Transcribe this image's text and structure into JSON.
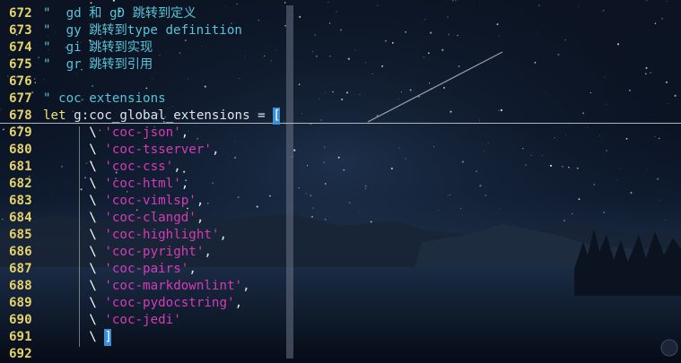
{
  "editor": {
    "lines": [
      {
        "num": "672",
        "parts": [
          {
            "c": "cmt",
            "t": "\"  gd 和 gD 跳转到定义"
          }
        ]
      },
      {
        "num": "673",
        "parts": [
          {
            "c": "cmt",
            "t": "\"  gy 跳转到type definition"
          }
        ]
      },
      {
        "num": "674",
        "parts": [
          {
            "c": "cmt",
            "t": "\"  gi 跳转到实现"
          }
        ]
      },
      {
        "num": "675",
        "parts": [
          {
            "c": "cmt",
            "t": "\"  gr 跳转到引用"
          }
        ]
      },
      {
        "num": "676",
        "parts": []
      },
      {
        "num": "677",
        "parts": [
          {
            "c": "cmt",
            "t": "\" coc extensions"
          }
        ]
      },
      {
        "num": "678",
        "parts": [
          {
            "c": "kw",
            "t": "let "
          },
          {
            "c": "op",
            "t": "g:coc_global_extensions = "
          },
          {
            "c": "cur",
            "t": "["
          }
        ]
      },
      {
        "num": "679",
        "parts": [
          {
            "c": "sp",
            "t": "      "
          },
          {
            "c": "bs",
            "t": "\\ "
          },
          {
            "c": "str",
            "t": "'coc-json'"
          },
          {
            "c": "op",
            "t": ","
          }
        ]
      },
      {
        "num": "680",
        "parts": [
          {
            "c": "sp",
            "t": "      "
          },
          {
            "c": "bs",
            "t": "\\ "
          },
          {
            "c": "str",
            "t": "'coc-tsserver'"
          },
          {
            "c": "op",
            "t": ","
          }
        ]
      },
      {
        "num": "681",
        "parts": [
          {
            "c": "sp",
            "t": "      "
          },
          {
            "c": "bs",
            "t": "\\ "
          },
          {
            "c": "str",
            "t": "'coc-css'"
          },
          {
            "c": "op",
            "t": ","
          }
        ]
      },
      {
        "num": "682",
        "parts": [
          {
            "c": "sp",
            "t": "      "
          },
          {
            "c": "bs",
            "t": "\\ "
          },
          {
            "c": "str",
            "t": "'coc-html'"
          },
          {
            "c": "op",
            "t": ","
          }
        ]
      },
      {
        "num": "683",
        "parts": [
          {
            "c": "sp",
            "t": "      "
          },
          {
            "c": "bs",
            "t": "\\ "
          },
          {
            "c": "str",
            "t": "'coc-vimlsp'"
          },
          {
            "c": "op",
            "t": ","
          }
        ]
      },
      {
        "num": "684",
        "parts": [
          {
            "c": "sp",
            "t": "      "
          },
          {
            "c": "bs",
            "t": "\\ "
          },
          {
            "c": "str",
            "t": "'coc-clangd'"
          },
          {
            "c": "op",
            "t": ","
          }
        ]
      },
      {
        "num": "685",
        "parts": [
          {
            "c": "sp",
            "t": "      "
          },
          {
            "c": "bs",
            "t": "\\ "
          },
          {
            "c": "str",
            "t": "'coc-highlight'"
          },
          {
            "c": "op",
            "t": ","
          }
        ]
      },
      {
        "num": "686",
        "parts": [
          {
            "c": "sp",
            "t": "      "
          },
          {
            "c": "bs",
            "t": "\\ "
          },
          {
            "c": "str",
            "t": "'coc-pyright'"
          },
          {
            "c": "op",
            "t": ","
          }
        ]
      },
      {
        "num": "687",
        "parts": [
          {
            "c": "sp",
            "t": "      "
          },
          {
            "c": "bs",
            "t": "\\ "
          },
          {
            "c": "str",
            "t": "'coc-pairs'"
          },
          {
            "c": "op",
            "t": ","
          }
        ]
      },
      {
        "num": "688",
        "parts": [
          {
            "c": "sp",
            "t": "      "
          },
          {
            "c": "bs",
            "t": "\\ "
          },
          {
            "c": "str",
            "t": "'coc-markdownlint'"
          },
          {
            "c": "op",
            "t": ","
          }
        ]
      },
      {
        "num": "689",
        "parts": [
          {
            "c": "sp",
            "t": "      "
          },
          {
            "c": "bs",
            "t": "\\ "
          },
          {
            "c": "str",
            "t": "'coc-pydocstring'"
          },
          {
            "c": "op",
            "t": ","
          }
        ]
      },
      {
        "num": "690",
        "parts": [
          {
            "c": "sp",
            "t": "      "
          },
          {
            "c": "bs",
            "t": "\\ "
          },
          {
            "c": "str",
            "t": "'coc-jedi'"
          }
        ]
      },
      {
        "num": "691",
        "parts": [
          {
            "c": "sp",
            "t": "      "
          },
          {
            "c": "bs",
            "t": "\\ "
          },
          {
            "c": "cur",
            "t": "]"
          }
        ]
      },
      {
        "num": "692",
        "parts": []
      }
    ],
    "cursor_line_num": "678"
  },
  "colors": {
    "line_number": "#e6d36b",
    "comment": "#58c3d6",
    "keyword": "#f1e37a",
    "string": "#d53bb7",
    "cursor_match": "#3c8fd6"
  }
}
